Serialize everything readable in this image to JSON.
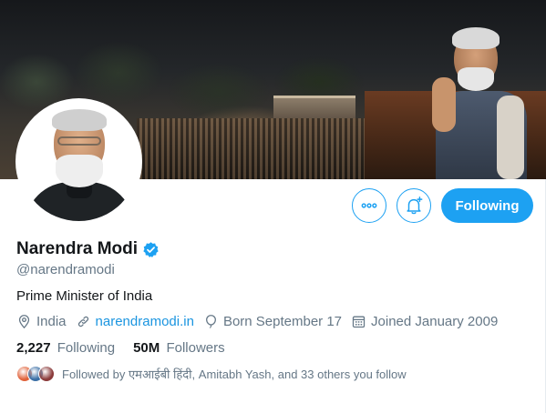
{
  "profile": {
    "name": "Narendra Modi",
    "handle": "@narendramodi",
    "bio": "Prime Minister of India",
    "verified": true,
    "location": "India",
    "website": "narendramodi.in",
    "birthday": "Born September 17",
    "joined": "Joined January 2009"
  },
  "stats": {
    "following_count": "2,227",
    "following_label": "Following",
    "followers_count": "50M",
    "followers_label": "Followers"
  },
  "followed_by": {
    "text": "Followed by एमआईबी हिंदी, Amitabh Yash, and 33 others you follow",
    "avatar_colors": [
      "#e0623a",
      "#3a6ea5",
      "#8a3a3a"
    ]
  },
  "actions": {
    "more_icon": "more-horizontal-icon",
    "notify_icon": "bell-plus-icon",
    "following_label": "Following"
  },
  "colors": {
    "accent": "#1da1f2",
    "link": "#1b95e0",
    "muted": "#657786",
    "text": "#14171a"
  }
}
